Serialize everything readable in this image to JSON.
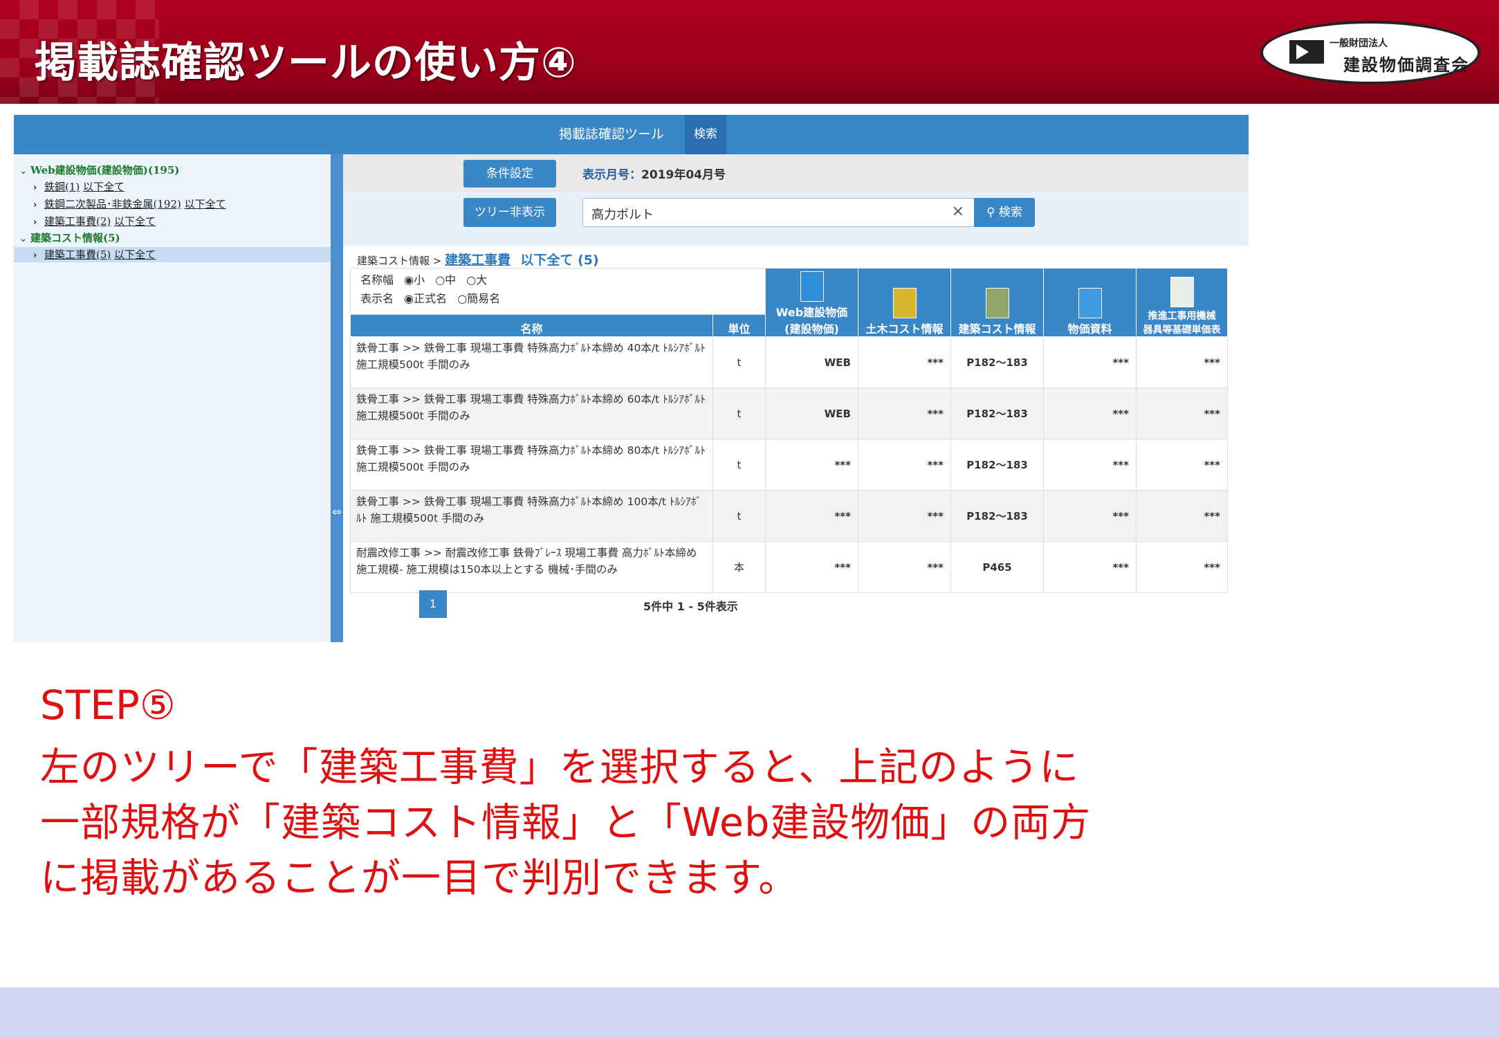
{
  "slide": {
    "title": "掲載誌確認ツールの使い方④",
    "logo": {
      "org_small": "一般財団法人",
      "org_name": "建設物価調査会"
    },
    "step_title": "STEP⑤",
    "step_lines": [
      "左のツリーで「建築工事費」を選択すると、上記のように",
      "一部規格が「建築コスト情報」と「Web建設物価」の両方",
      "に掲載があることが一目で判別できます。"
    ]
  },
  "app": {
    "title": "掲載誌確認ツール",
    "search_tab": "検索",
    "sidebar": {
      "items": [
        {
          "type": "group",
          "label": "Web建設物価(建設物価)(195)"
        },
        {
          "type": "child",
          "label": "鉄鋼(1)",
          "link": "以下全て"
        },
        {
          "type": "child",
          "label": "鉄鋼二次製品･非鉄金属(192)",
          "link": "以下全て"
        },
        {
          "type": "child",
          "label": "建築工事費(2)",
          "link": "以下全て"
        },
        {
          "type": "group",
          "label": "建築コスト情報(5)"
        },
        {
          "type": "child",
          "label": "建築工事費(5)",
          "link": "以下全て",
          "selected": true
        }
      ],
      "splitter_icon": "⇔"
    },
    "toolbar": {
      "condition_button": "条件設定",
      "month_label": "表示月号：",
      "month_value": "2019年04月号",
      "tree_toggle_button": "ツリー非表示",
      "search_value": "高力ボルト",
      "clear_icon": "×",
      "search_button": "検索"
    },
    "breadcrumb": {
      "root": "建築コスト情報",
      "separator": ">",
      "current": "建築工事費",
      "all_link": "以下全て (5)"
    },
    "options": {
      "width_label": "名称幅",
      "width_options": [
        "小",
        "中",
        "大"
      ],
      "width_selected": "小",
      "display_label": "表示名",
      "display_options": [
        "正式名",
        "簡易名"
      ],
      "display_selected": "正式名"
    },
    "table": {
      "headers": {
        "name": "名称",
        "unit": "単位",
        "publications": [
          {
            "label_line1": "Web建設物価",
            "label_line2": "(建設物価)",
            "cover_color": "#2f8fd6"
          },
          {
            "label_line1": "",
            "label_line2": "土木コスト情報",
            "cover_color": "#d6b52f"
          },
          {
            "label_line1": "",
            "label_line2": "建築コスト情報",
            "cover_color": "#8fa86a"
          },
          {
            "label_line1": "",
            "label_line2": "物価資料",
            "cover_color": "#3f9be0"
          },
          {
            "label_line1": "推進工事用機械",
            "label_line2": "器具等基礎単価表",
            "cover_color": "#e8efe8"
          }
        ]
      },
      "rows": [
        {
          "name": "鉄骨工事 >> 鉄骨工事 現場工事費 特殊高力ﾎﾞﾙﾄ本締め 40本/t ﾄﾙｼｱﾎﾞﾙﾄ 施工規模500t 手間のみ",
          "unit": "t",
          "values": [
            "WEB",
            "***",
            "P182～183",
            "***",
            "***"
          ]
        },
        {
          "name": "鉄骨工事 >> 鉄骨工事 現場工事費 特殊高力ﾎﾞﾙﾄ本締め 60本/t ﾄﾙｼｱﾎﾞﾙﾄ 施工規模500t 手間のみ",
          "unit": "t",
          "values": [
            "WEB",
            "***",
            "P182～183",
            "***",
            "***"
          ]
        },
        {
          "name": "鉄骨工事 >> 鉄骨工事 現場工事費 特殊高力ﾎﾞﾙﾄ本締め 80本/t ﾄﾙｼｱﾎﾞﾙﾄ 施工規模500t 手間のみ",
          "unit": "t",
          "values": [
            "***",
            "***",
            "P182～183",
            "***",
            "***"
          ]
        },
        {
          "name": "鉄骨工事 >> 鉄骨工事 現場工事費 特殊高力ﾎﾞﾙﾄ本締め 100本/t ﾄﾙｼｱﾎﾞﾙﾄ 施工規模500t 手間のみ",
          "unit": "t",
          "values": [
            "***",
            "***",
            "P182～183",
            "***",
            "***"
          ]
        },
        {
          "name": "耐震改修工事 >> 耐震改修工事 鉄骨ﾌﾞﾚｰｽ 現場工事費 高力ﾎﾞﾙﾄ本締め 施工規模- 施工規模は150本以上とする 機械･手間のみ",
          "unit": "本",
          "values": [
            "***",
            "***",
            "P465",
            "***",
            "***"
          ]
        }
      ]
    },
    "pager": {
      "current_page": "1",
      "summary": "5件中 1 - 5件表示"
    }
  }
}
